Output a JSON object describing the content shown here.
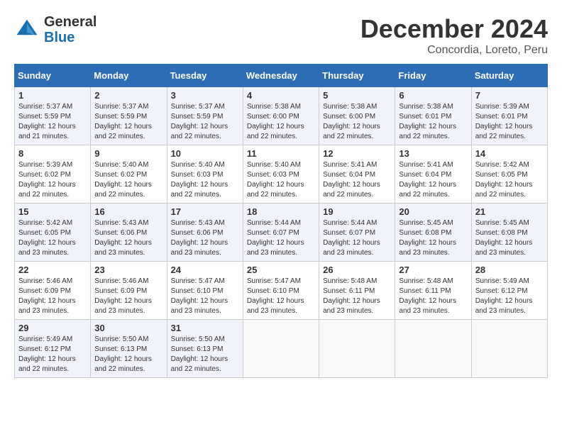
{
  "logo": {
    "general": "General",
    "blue": "Blue"
  },
  "header": {
    "month": "December 2024",
    "location": "Concordia, Loreto, Peru"
  },
  "weekdays": [
    "Sunday",
    "Monday",
    "Tuesday",
    "Wednesday",
    "Thursday",
    "Friday",
    "Saturday"
  ],
  "weeks": [
    [
      {
        "day": "1",
        "sunrise": "5:37 AM",
        "sunset": "5:59 PM",
        "daylight": "12 hours and 21 minutes"
      },
      {
        "day": "2",
        "sunrise": "5:37 AM",
        "sunset": "5:59 PM",
        "daylight": "12 hours and 22 minutes"
      },
      {
        "day": "3",
        "sunrise": "5:37 AM",
        "sunset": "5:59 PM",
        "daylight": "12 hours and 22 minutes"
      },
      {
        "day": "4",
        "sunrise": "5:38 AM",
        "sunset": "6:00 PM",
        "daylight": "12 hours and 22 minutes"
      },
      {
        "day": "5",
        "sunrise": "5:38 AM",
        "sunset": "6:00 PM",
        "daylight": "12 hours and 22 minutes"
      },
      {
        "day": "6",
        "sunrise": "5:38 AM",
        "sunset": "6:01 PM",
        "daylight": "12 hours and 22 minutes"
      },
      {
        "day": "7",
        "sunrise": "5:39 AM",
        "sunset": "6:01 PM",
        "daylight": "12 hours and 22 minutes"
      }
    ],
    [
      {
        "day": "8",
        "sunrise": "5:39 AM",
        "sunset": "6:02 PM",
        "daylight": "12 hours and 22 minutes"
      },
      {
        "day": "9",
        "sunrise": "5:40 AM",
        "sunset": "6:02 PM",
        "daylight": "12 hours and 22 minutes"
      },
      {
        "day": "10",
        "sunrise": "5:40 AM",
        "sunset": "6:03 PM",
        "daylight": "12 hours and 22 minutes"
      },
      {
        "day": "11",
        "sunrise": "5:40 AM",
        "sunset": "6:03 PM",
        "daylight": "12 hours and 22 minutes"
      },
      {
        "day": "12",
        "sunrise": "5:41 AM",
        "sunset": "6:04 PM",
        "daylight": "12 hours and 22 minutes"
      },
      {
        "day": "13",
        "sunrise": "5:41 AM",
        "sunset": "6:04 PM",
        "daylight": "12 hours and 22 minutes"
      },
      {
        "day": "14",
        "sunrise": "5:42 AM",
        "sunset": "6:05 PM",
        "daylight": "12 hours and 22 minutes"
      }
    ],
    [
      {
        "day": "15",
        "sunrise": "5:42 AM",
        "sunset": "6:05 PM",
        "daylight": "12 hours and 23 minutes"
      },
      {
        "day": "16",
        "sunrise": "5:43 AM",
        "sunset": "6:06 PM",
        "daylight": "12 hours and 23 minutes"
      },
      {
        "day": "17",
        "sunrise": "5:43 AM",
        "sunset": "6:06 PM",
        "daylight": "12 hours and 23 minutes"
      },
      {
        "day": "18",
        "sunrise": "5:44 AM",
        "sunset": "6:07 PM",
        "daylight": "12 hours and 23 minutes"
      },
      {
        "day": "19",
        "sunrise": "5:44 AM",
        "sunset": "6:07 PM",
        "daylight": "12 hours and 23 minutes"
      },
      {
        "day": "20",
        "sunrise": "5:45 AM",
        "sunset": "6:08 PM",
        "daylight": "12 hours and 23 minutes"
      },
      {
        "day": "21",
        "sunrise": "5:45 AM",
        "sunset": "6:08 PM",
        "daylight": "12 hours and 23 minutes"
      }
    ],
    [
      {
        "day": "22",
        "sunrise": "5:46 AM",
        "sunset": "6:09 PM",
        "daylight": "12 hours and 23 minutes"
      },
      {
        "day": "23",
        "sunrise": "5:46 AM",
        "sunset": "6:09 PM",
        "daylight": "12 hours and 23 minutes"
      },
      {
        "day": "24",
        "sunrise": "5:47 AM",
        "sunset": "6:10 PM",
        "daylight": "12 hours and 23 minutes"
      },
      {
        "day": "25",
        "sunrise": "5:47 AM",
        "sunset": "6:10 PM",
        "daylight": "12 hours and 23 minutes"
      },
      {
        "day": "26",
        "sunrise": "5:48 AM",
        "sunset": "6:11 PM",
        "daylight": "12 hours and 23 minutes"
      },
      {
        "day": "27",
        "sunrise": "5:48 AM",
        "sunset": "6:11 PM",
        "daylight": "12 hours and 23 minutes"
      },
      {
        "day": "28",
        "sunrise": "5:49 AM",
        "sunset": "6:12 PM",
        "daylight": "12 hours and 23 minutes"
      }
    ],
    [
      {
        "day": "29",
        "sunrise": "5:49 AM",
        "sunset": "6:12 PM",
        "daylight": "12 hours and 22 minutes"
      },
      {
        "day": "30",
        "sunrise": "5:50 AM",
        "sunset": "6:13 PM",
        "daylight": "12 hours and 22 minutes"
      },
      {
        "day": "31",
        "sunrise": "5:50 AM",
        "sunset": "6:13 PM",
        "daylight": "12 hours and 22 minutes"
      },
      null,
      null,
      null,
      null
    ]
  ]
}
